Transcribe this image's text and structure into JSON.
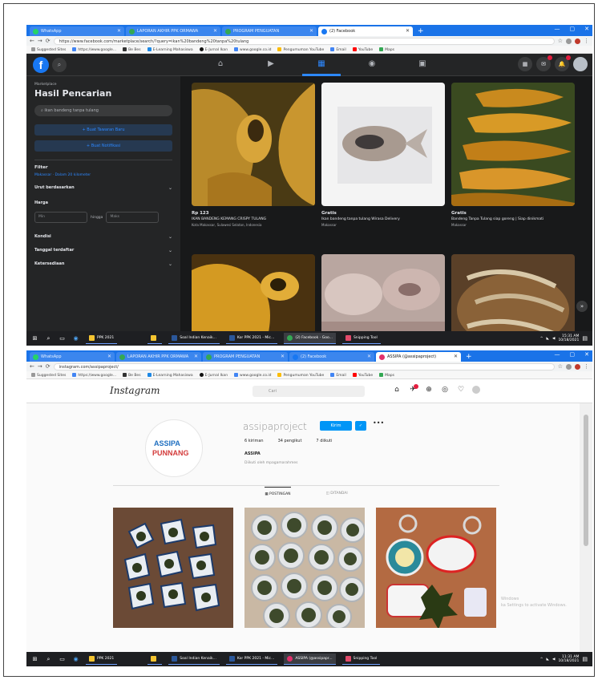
{
  "browser1": {
    "tabs": [
      {
        "title": "WhatsApp",
        "active": false
      },
      {
        "title": "LAPORAN AKHIR PPK ORMAWA",
        "active": false
      },
      {
        "title": "PROGRAM PENGUATAN",
        "active": false
      },
      {
        "title": "(2) Facebook",
        "active": true
      }
    ],
    "url": "https://www.facebook.com/marketplace/search/?query=ikan%20bandeng%20tanpa%20tulang",
    "bookmarks": [
      "Suggested Sites",
      "https://www.google...",
      "Be Bes",
      "E-Learning Mahasiswa",
      "E-Jurnal Ikan",
      "www.google.co.id",
      "Pengumuman YouTube",
      "Email",
      "YouTube",
      "Maps"
    ]
  },
  "facebook": {
    "crumb": "Marketplace",
    "heading": "Hasil Pencarian",
    "search_value": "ikan bandeng tanpa tulang",
    "btn_create": "+ Buat Tawaran Baru",
    "btn_alert": "+ Buat Notifikasi",
    "filter_heading": "Filter",
    "location": "Makassar · Dalam 20 kilometer",
    "sort": "Urut berdasarkan",
    "price_label": "Harga",
    "price_min": "Min",
    "price_sep": "hingga",
    "price_max": "Maks",
    "cond": "Kondisi",
    "date": "Tanggal terdaftar",
    "avail": "Ketersediaan",
    "listings": [
      {
        "price": "Rp 123",
        "title": "IKAN BANDENG KEMANG CRISPY TULANG",
        "location": "Kota Makassar, Sulawesi Selatan, Indonesia"
      },
      {
        "price": "Gratis",
        "title": "Ikan bandeng tanpa tulang Wirasa Delivery",
        "location": "Makassar"
      },
      {
        "price": "Gratis",
        "title": "Bandeng Tanpa Tulang siap goreng | Siap dinikmati",
        "location": "Makassar"
      }
    ]
  },
  "taskbar1": {
    "apps": [
      "PPK 2021",
      "",
      "Soal Indian Kenaik...",
      "Kor PPK 2021 - Mic...",
      "(2) Facebook - Goo...",
      "Snipping Tool"
    ],
    "time": "15:31 AM",
    "date": "10/18/2021"
  },
  "browser2": {
    "tabs": [
      {
        "title": "WhatsApp",
        "active": false
      },
      {
        "title": "LAPORAN AKHIR PPK ORMAWA",
        "active": false
      },
      {
        "title": "PROGRAM PENGUATAN",
        "active": false
      },
      {
        "title": "(2) Facebook",
        "active": false
      },
      {
        "title": "ASSIPA (@assipaproject)",
        "active": true
      }
    ],
    "url": "instagram.com/assipaproject/",
    "bookmarks": [
      "Suggested Sites",
      "https://www.google...",
      "Be Bes",
      "E-Learning Mahasiswa",
      "E-Jurnal Ikan",
      "www.google.co.id",
      "Pengumuman YouTube",
      "Email",
      "YouTube",
      "Maps"
    ]
  },
  "instagram": {
    "logo": "Instagram",
    "search_placeholder": "Cari",
    "username": "assipaproject",
    "message_btn": "Kirim",
    "follow_btn": "✓",
    "stats": [
      "6 kiriman",
      "34 pengikut",
      "7 diikuti"
    ],
    "full_name": "ASSIPA",
    "followed_by": "Diikuti oleh mpagamarahmes",
    "tabs": [
      "POSTINGAN",
      "DITANDAI"
    ],
    "avatar_line1": "ASSIPA",
    "avatar_line2": "PUNNANG",
    "watermark_l1": "Windows",
    "watermark_l2": "ka Settings to activate Windows."
  },
  "taskbar2": {
    "apps": [
      "PPK 2021",
      "",
      "Soal Indian Kenaik...",
      "Kor PPK 2021 - Mic...",
      "ASSIPA (@assipapr...",
      "Snipping Tool"
    ],
    "time": "11:31 AM",
    "date": "10/18/2021"
  },
  "colors": {
    "fb_blue": "#1877f2",
    "chrome_blue": "#1a73e8",
    "ig_blue": "#0095f6"
  }
}
